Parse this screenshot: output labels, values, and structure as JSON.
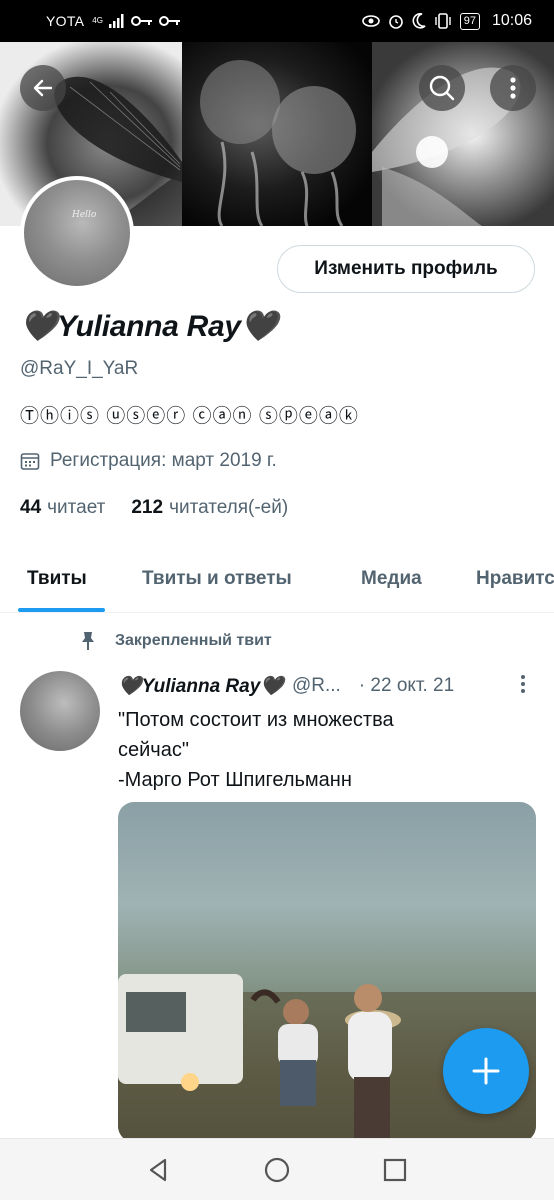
{
  "status_bar": {
    "carrier": "YOTA",
    "network_type": "4G",
    "battery": "97",
    "time": "10:06",
    "icons": [
      "signal-icon",
      "key-icon",
      "key-icon",
      "eye-icon",
      "alarm-icon",
      "moon-icon",
      "vibrate-icon",
      "battery-icon"
    ]
  },
  "header": {
    "back_icon": "arrow-left-icon",
    "search_icon": "search-icon",
    "more_icon": "more-vertical-icon"
  },
  "profile": {
    "avatar_caption": "Hello",
    "edit_button_label": "Изменить профиль",
    "display_name": "🖤Yulianna Ray🖤",
    "handle": "@RaY_I_YaR",
    "bio": "Ⓣⓗⓘⓢ ⓤⓢⓔⓡ ⓒⓐⓝ ⓢⓟⓔⓐⓚ",
    "joined": "Регистрация: март 2019 г.",
    "following_count": "44",
    "following_label": "читает",
    "followers_count": "212",
    "followers_label": "читателя(-ей)"
  },
  "tabs": [
    {
      "label": "Твиты",
      "active": true
    },
    {
      "label": "Твиты и ответы",
      "active": false
    },
    {
      "label": "Медиа",
      "active": false
    },
    {
      "label": "Нравится",
      "active": false
    }
  ],
  "tweet": {
    "pinned_label": "Закрепленный твит",
    "author_name": "🖤Yulianna Ray🖤",
    "author_handle": "@R...",
    "date": "· 22 окт. 21",
    "text_line1": "\"Потом состоит из множества",
    "text_line2": "сейчас\"",
    "text_line3": "-Марго Рот Шпигельманн"
  },
  "fab": {
    "icon": "plus-icon"
  },
  "nav_bar": {
    "icons": [
      "back-triangle-icon",
      "home-circle-icon",
      "recents-square-icon"
    ]
  },
  "colors": {
    "accent": "#1d9bf0",
    "text_primary": "#0f1419",
    "text_secondary": "#536471",
    "border": "#cfd9de"
  }
}
